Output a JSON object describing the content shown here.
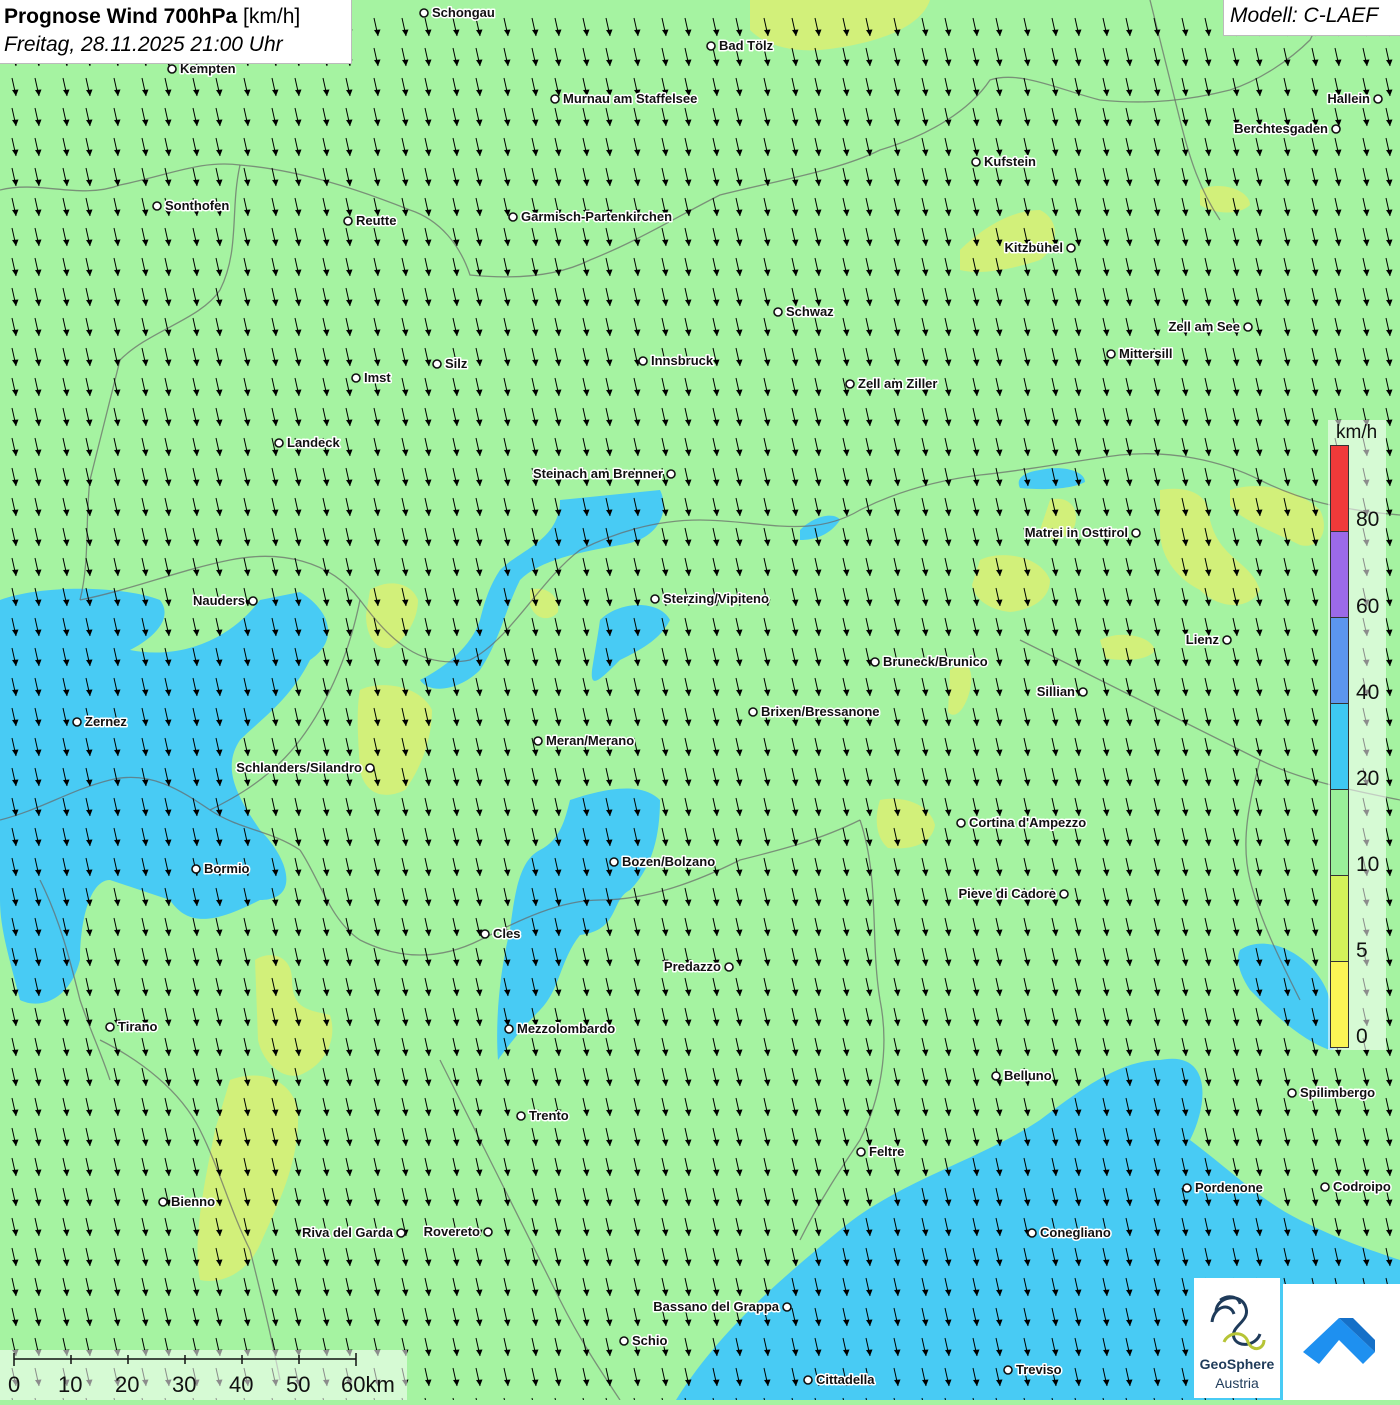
{
  "header": {
    "title_bold": "Prognose Wind 700hPa",
    "title_unit": "[km/h]",
    "datetime": "Freitag, 28.11.2025 21:00 Uhr",
    "model": "Modell: C-LAEF"
  },
  "colors": {
    "background_green": "#a5f3a1",
    "cyan_20_40": "#48cbf4",
    "yellow_5_10": "#d2f07a",
    "wind_arrow": "#000000",
    "border_line": "#666666"
  },
  "legend": {
    "unit": "km/h",
    "labels": [
      "80",
      "60",
      "40",
      "20",
      "10",
      "5",
      "0"
    ],
    "colors_top_to_bottom": [
      "#f03a3a",
      "#9b6ae8",
      "#5c96ee",
      "#3ec8f2",
      "#9af09a",
      "#d4f25a",
      "#fbf555"
    ]
  },
  "scalebar": {
    "labels": [
      "0",
      "10",
      "20",
      "30",
      "40",
      "50",
      "60km"
    ]
  },
  "cities": [
    {
      "name": "Schongau"
    },
    {
      "name": "Bad Tölz"
    },
    {
      "name": "Kempten"
    },
    {
      "name": "Murnau am Staffelsee"
    },
    {
      "name": "Hallein"
    },
    {
      "name": "Berchtesgaden"
    },
    {
      "name": "Kufstein"
    },
    {
      "name": "Sonthofen"
    },
    {
      "name": "Reutte"
    },
    {
      "name": "Garmisch-Partenkirchen"
    },
    {
      "name": "Kitzbühel"
    },
    {
      "name": "Schwaz"
    },
    {
      "name": "Zell am See"
    },
    {
      "name": "Mittersill"
    },
    {
      "name": "Innsbruck"
    },
    {
      "name": "Silz"
    },
    {
      "name": "Imst"
    },
    {
      "name": "Zell am Ziller"
    },
    {
      "name": "Landeck"
    },
    {
      "name": "Steinach am Brenner"
    },
    {
      "name": "Matrei in Osttirol"
    },
    {
      "name": "Nauders"
    },
    {
      "name": "Sterzing/Vipiteno"
    },
    {
      "name": "Lienz"
    },
    {
      "name": "Bruneck/Brunico"
    },
    {
      "name": "Sillian"
    },
    {
      "name": "Zernez"
    },
    {
      "name": "Brixen/Bressanone"
    },
    {
      "name": "Meran/Merano"
    },
    {
      "name": "Schlanders/Silandro"
    },
    {
      "name": "Cortina d'Ampezzo"
    },
    {
      "name": "Bozen/Bolzano"
    },
    {
      "name": "Bormio"
    },
    {
      "name": "Pieve di Cadore"
    },
    {
      "name": "Cles"
    },
    {
      "name": "Predazzo"
    },
    {
      "name": "Tirano"
    },
    {
      "name": "Mezzolombardo"
    },
    {
      "name": "Belluno"
    },
    {
      "name": "Spilimbergo"
    },
    {
      "name": "Trento"
    },
    {
      "name": "Feltre"
    },
    {
      "name": "Pordenone"
    },
    {
      "name": "Codroipo"
    },
    {
      "name": "Bienno"
    },
    {
      "name": "Riva del Garda"
    },
    {
      "name": "Rovereto"
    },
    {
      "name": "Conegliano"
    },
    {
      "name": "Bassano del Grappa"
    },
    {
      "name": "Schio"
    },
    {
      "name": "Treviso"
    },
    {
      "name": "Cittadella"
    }
  ],
  "logos": {
    "geosphere_line1": "GeoSphere",
    "geosphere_line2": "Austria"
  }
}
